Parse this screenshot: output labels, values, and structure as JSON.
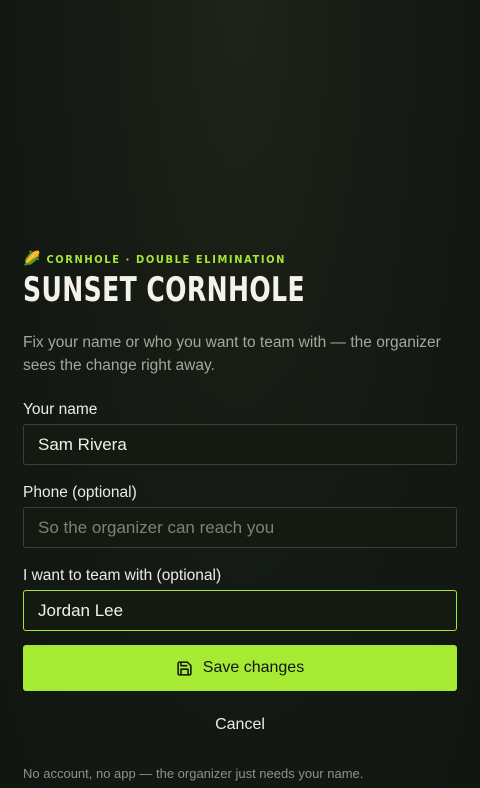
{
  "header": {
    "corn_emoji": "🌽",
    "eyebrow": "CORNHOLE · DOUBLE ELIMINATION",
    "title": "SUNSET CORNHOLE",
    "subtitle": "Fix your name or who you want to team with — the organizer sees the change right away."
  },
  "form": {
    "name": {
      "label": "Your name",
      "value": "Sam Rivera",
      "placeholder": ""
    },
    "phone": {
      "label": "Phone (optional)",
      "value": "",
      "placeholder": "So the organizer can reach you"
    },
    "teammate": {
      "label": "I want to team with (optional)",
      "value": "Jordan Lee",
      "placeholder": ""
    }
  },
  "actions": {
    "save_label": "Save changes",
    "save_icon": "save-icon",
    "cancel_label": "Cancel"
  },
  "footer": {
    "note": "No account, no app — the organizer just needs your name."
  },
  "colors": {
    "accent": "#a6ea34",
    "background": "#131812"
  }
}
